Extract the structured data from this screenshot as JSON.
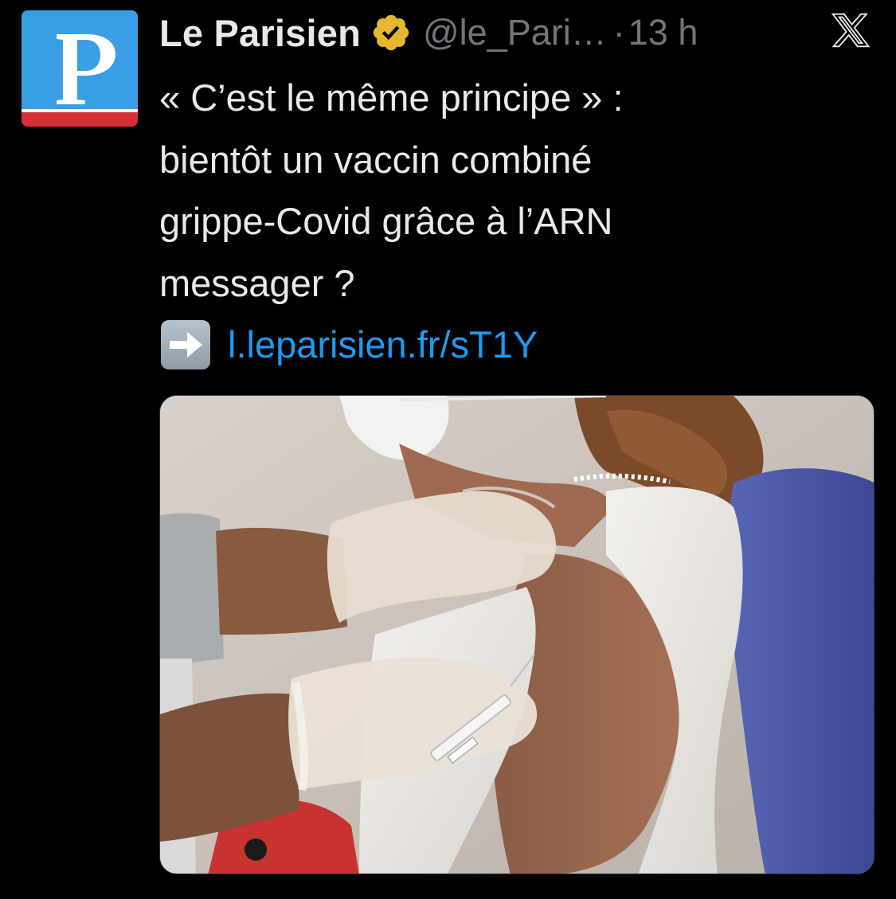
{
  "tweet": {
    "author": {
      "display_name": "Le Parisien",
      "handle": "@le_Pari…",
      "verified": true,
      "verified_color": "#e8b730",
      "avatar_letter": "P",
      "avatar_colors": {
        "background": "#3a9ee4",
        "stripe": "#d62f38",
        "letter": "#ffffff"
      }
    },
    "separator": "·",
    "time": "13 h",
    "platform_icon": "x-logo-icon",
    "text_lines": [
      "« C’est le même principe » :",
      "bientôt un vaccin combiné",
      "grippe-Covid grâce à l’ARN",
      "messager ?"
    ],
    "link_emoji": "right-arrow-emoji-icon",
    "link_text": "l.leparisien.fr/sT1Y",
    "link_color": "#1d9bf0",
    "media": {
      "type": "photo"
    }
  },
  "colors": {
    "background": "#000000",
    "text_primary": "#e7e9ea",
    "text_secondary": "#71767b"
  }
}
